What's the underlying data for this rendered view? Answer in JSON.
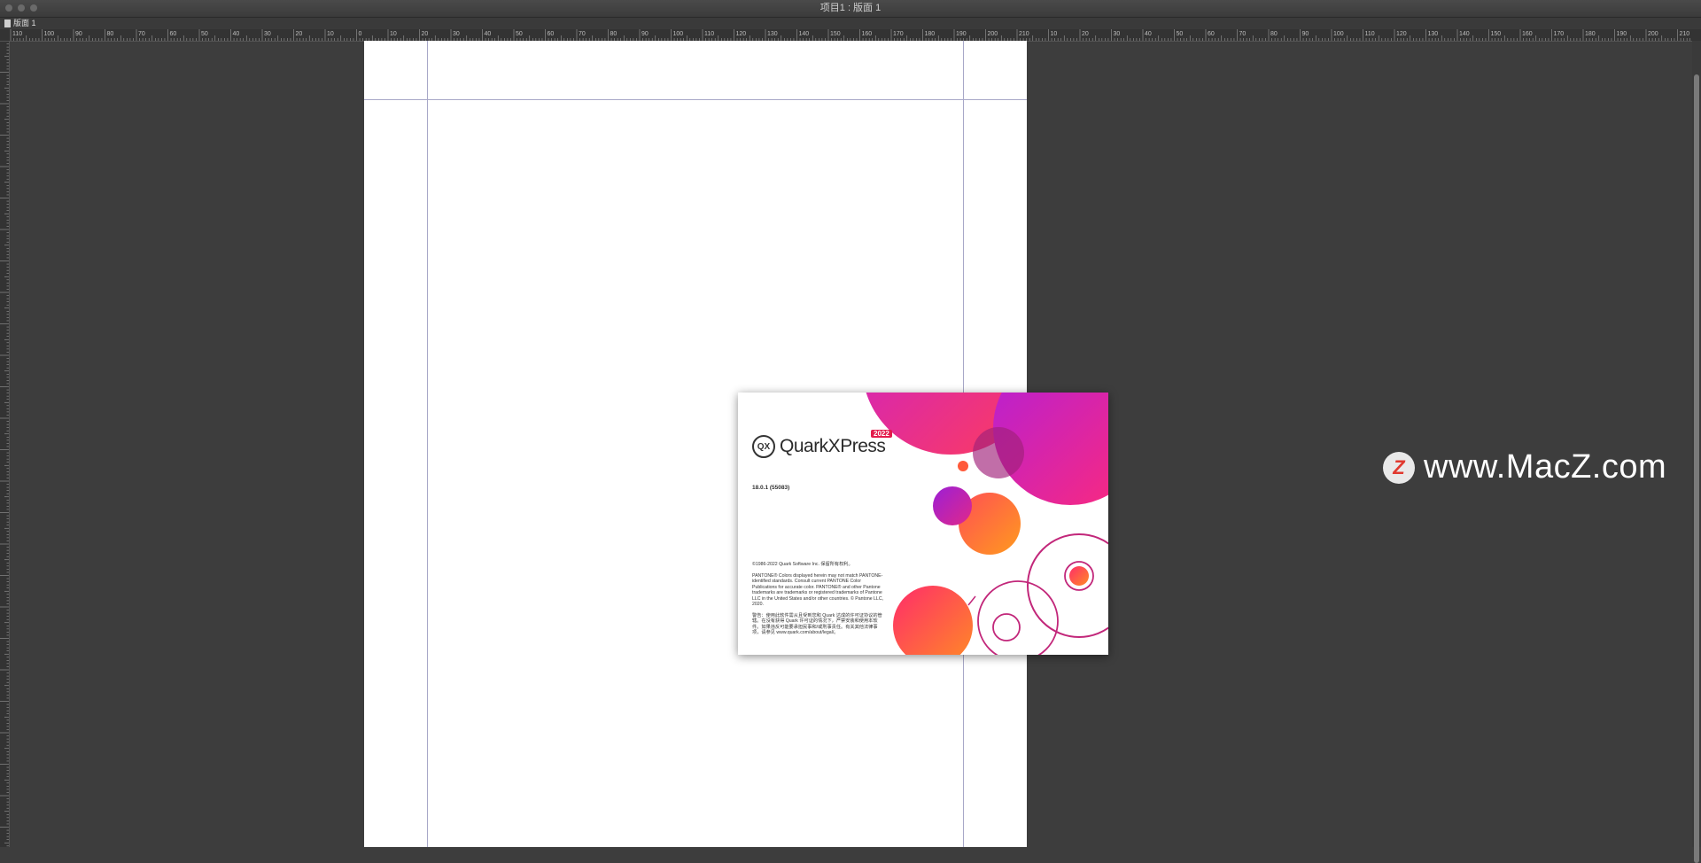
{
  "window": {
    "title": "项目1 : 版面 1"
  },
  "tab": {
    "label": "版面 1"
  },
  "ruler": {
    "ticks": [
      "110",
      "100",
      "90",
      "80",
      "70",
      "60",
      "50",
      "40",
      "30",
      "20",
      "10",
      "0",
      "10",
      "20",
      "30",
      "40",
      "50",
      "60",
      "70",
      "80",
      "90",
      "100",
      "110",
      "120",
      "130",
      "140",
      "150",
      "160",
      "170",
      "180",
      "190",
      "200",
      "210",
      "10",
      "20",
      "30",
      "40",
      "50",
      "60",
      "70",
      "80",
      "90",
      "100",
      "110",
      "120",
      "130",
      "140",
      "150",
      "160",
      "170",
      "180",
      "190",
      "200",
      "210"
    ]
  },
  "splash": {
    "brand": "QuarkXPress",
    "logo_mark": "QX",
    "year": "2022",
    "version": "18.0.1 (55083)",
    "copyright": "©1986-2022 Quark Software Inc. 保留所有权利。",
    "pantone": "PANTONE® Colors displayed herein may not match PANTONE-identified standards. Consult current PANTONE Color Publications for accurate color. PANTONE® and other Pantone trademarks are trademarks or registered trademarks of Pantone LLC in the United States and/or other countries. © Pantone LLC, 2020.",
    "warning": "警告：使用此软件需从且受到您和 Quark 达成的许可证协议的管辖。在没有获得 Quark 许可证的情况下，严禁安装和使用本软件。如果违反可能要承担民事和/或刑事责任。有关其他法律事项，请参见 www.quark.com/about/legal/。"
  },
  "watermark": {
    "icon": "Z",
    "text": "www.MacZ.com"
  }
}
